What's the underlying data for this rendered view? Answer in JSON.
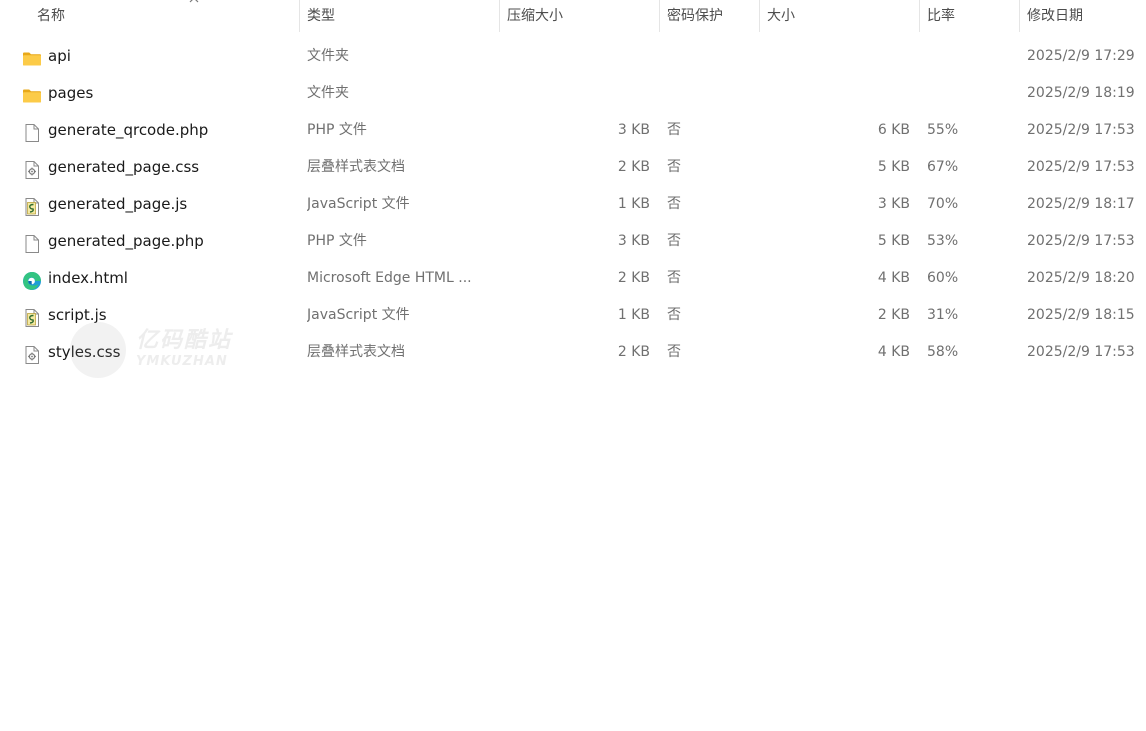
{
  "columns": [
    {
      "key": "name",
      "label": "名称"
    },
    {
      "key": "type",
      "label": "类型"
    },
    {
      "key": "compressed_size",
      "label": "压缩大小"
    },
    {
      "key": "password",
      "label": "密码保护"
    },
    {
      "key": "size",
      "label": "大小"
    },
    {
      "key": "ratio",
      "label": "比率"
    },
    {
      "key": "modified",
      "label": "修改日期"
    }
  ],
  "sort": {
    "column": "name",
    "direction": "ascending"
  },
  "files": [
    {
      "name": "api",
      "icon": "folder-icon",
      "type": "文件夹",
      "compressed_size": "",
      "password": "",
      "size": "",
      "ratio": "",
      "modified": "2025/2/9 17:29"
    },
    {
      "name": "pages",
      "icon": "folder-icon",
      "type": "文件夹",
      "compressed_size": "",
      "password": "",
      "size": "",
      "ratio": "",
      "modified": "2025/2/9 18:19"
    },
    {
      "name": "generate_qrcode.php",
      "icon": "blank-file-icon",
      "type": "PHP 文件",
      "compressed_size": "3 KB",
      "password": "否",
      "size": "6 KB",
      "ratio": "55%",
      "modified": "2025/2/9 17:53"
    },
    {
      "name": "generated_page.css",
      "icon": "css-file-icon",
      "type": "层叠样式表文档",
      "compressed_size": "2 KB",
      "password": "否",
      "size": "5 KB",
      "ratio": "67%",
      "modified": "2025/2/9 17:53"
    },
    {
      "name": "generated_page.js",
      "icon": "js-file-icon",
      "type": "JavaScript 文件",
      "compressed_size": "1 KB",
      "password": "否",
      "size": "3 KB",
      "ratio": "70%",
      "modified": "2025/2/9 18:17"
    },
    {
      "name": "generated_page.php",
      "icon": "blank-file-icon",
      "type": "PHP 文件",
      "compressed_size": "3 KB",
      "password": "否",
      "size": "5 KB",
      "ratio": "53%",
      "modified": "2025/2/9 17:53"
    },
    {
      "name": "index.html",
      "icon": "edge-icon",
      "type": "Microsoft Edge HTML ...",
      "compressed_size": "2 KB",
      "password": "否",
      "size": "4 KB",
      "ratio": "60%",
      "modified": "2025/2/9 18:20"
    },
    {
      "name": "script.js",
      "icon": "js-file-icon",
      "type": "JavaScript 文件",
      "compressed_size": "1 KB",
      "password": "否",
      "size": "2 KB",
      "ratio": "31%",
      "modified": "2025/2/9 18:15"
    },
    {
      "name": "styles.css",
      "icon": "css-file-icon",
      "type": "层叠样式表文档",
      "compressed_size": "2 KB",
      "password": "否",
      "size": "4 KB",
      "ratio": "58%",
      "modified": "2025/2/9 17:53"
    }
  ],
  "watermark": {
    "title": "亿码酷站",
    "subtitle": "YMKUZHAN"
  },
  "colors": {
    "header_text": "#4d4d4d",
    "name_text": "#1a1a1a",
    "detail_text": "#707070",
    "folder": "#f8c640",
    "separator": "#e5e5e5"
  }
}
